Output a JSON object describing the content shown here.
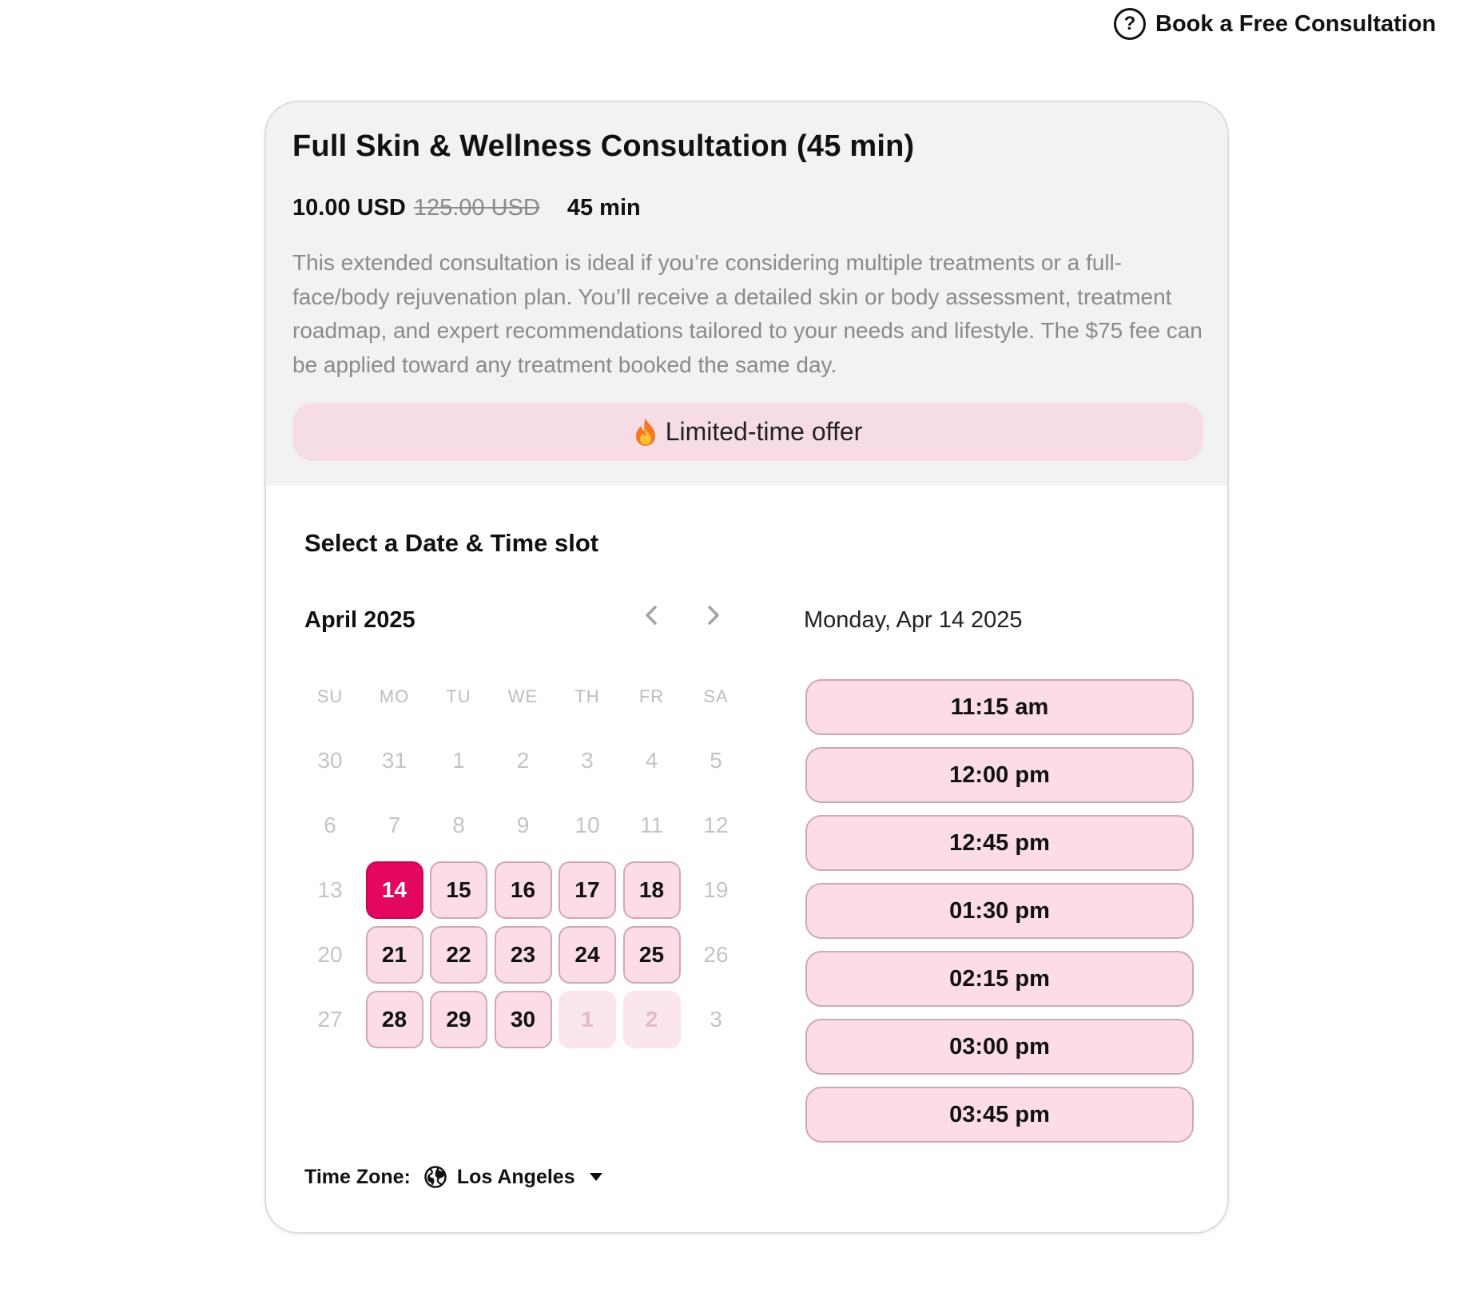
{
  "header": {
    "help_icon": "question-circle-icon",
    "help_label": "Book a Free Consultation"
  },
  "service": {
    "title": "Full Skin & Wellness Consultation (45 min)",
    "price_current": "10.00 USD",
    "price_original": "125.00 USD",
    "duration": "45 min",
    "description": "This extended consultation is ideal if you’re considering multiple treatments or a full-face/body rejuvenation plan. You’ll receive a detailed skin or body assessment, treatment roadmap, and expert recommendations tailored to your needs and lifestyle. The $75 fee can be applied toward any treatment booked the same day.",
    "offer_icon": "fire-icon",
    "offer_label": "Limited-time offer"
  },
  "scheduler": {
    "section_title": "Select a Date & Time slot",
    "month_label": "April 2025",
    "prev_icon": "chevron-left-icon",
    "next_icon": "chevron-right-icon",
    "selected_date_label": "Monday, Apr 14 2025",
    "weekdays": [
      "SU",
      "MO",
      "TU",
      "WE",
      "TH",
      "FR",
      "SA"
    ],
    "days": [
      {
        "label": "30",
        "state": "muted"
      },
      {
        "label": "31",
        "state": "muted"
      },
      {
        "label": "1",
        "state": "muted"
      },
      {
        "label": "2",
        "state": "muted"
      },
      {
        "label": "3",
        "state": "muted"
      },
      {
        "label": "4",
        "state": "muted"
      },
      {
        "label": "5",
        "state": "muted"
      },
      {
        "label": "6",
        "state": "muted"
      },
      {
        "label": "7",
        "state": "muted"
      },
      {
        "label": "8",
        "state": "muted"
      },
      {
        "label": "9",
        "state": "muted"
      },
      {
        "label": "10",
        "state": "muted"
      },
      {
        "label": "11",
        "state": "muted"
      },
      {
        "label": "12",
        "state": "muted"
      },
      {
        "label": "13",
        "state": "muted"
      },
      {
        "label": "14",
        "state": "selected"
      },
      {
        "label": "15",
        "state": "available"
      },
      {
        "label": "16",
        "state": "available"
      },
      {
        "label": "17",
        "state": "available"
      },
      {
        "label": "18",
        "state": "available"
      },
      {
        "label": "19",
        "state": "muted"
      },
      {
        "label": "20",
        "state": "muted"
      },
      {
        "label": "21",
        "state": "available"
      },
      {
        "label": "22",
        "state": "available"
      },
      {
        "label": "23",
        "state": "available"
      },
      {
        "label": "24",
        "state": "available"
      },
      {
        "label": "25",
        "state": "available"
      },
      {
        "label": "26",
        "state": "muted"
      },
      {
        "label": "27",
        "state": "muted"
      },
      {
        "label": "28",
        "state": "available"
      },
      {
        "label": "29",
        "state": "available"
      },
      {
        "label": "30",
        "state": "available"
      },
      {
        "label": "1",
        "state": "faded"
      },
      {
        "label": "2",
        "state": "faded"
      },
      {
        "label": "3",
        "state": "muted"
      }
    ],
    "time_slots": [
      "11:15 am",
      "12:00 pm",
      "12:45 pm",
      "01:30 pm",
      "02:15 pm",
      "03:00 pm",
      "03:45 pm"
    ],
    "timezone_label": "Time Zone:",
    "timezone_icon": "globe-icon",
    "timezone_value": "Los Angeles",
    "timezone_caret_icon": "caret-down-icon"
  },
  "colors": {
    "accent": "#e4075f",
    "slot_bg": "#fcdde6",
    "offer_bg": "#f6dde5",
    "header_bg": "#f2f2f2"
  }
}
